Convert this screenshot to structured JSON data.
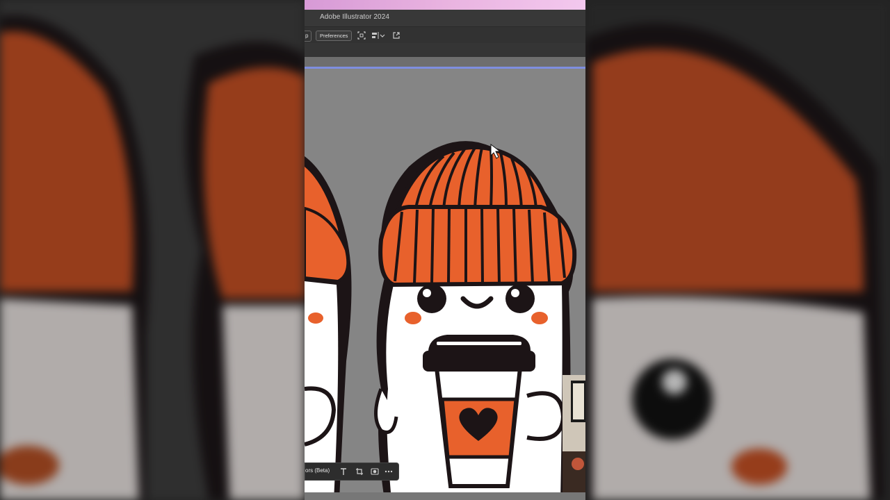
{
  "app": {
    "title": "Adobe Illustrator 2024"
  },
  "toolbar": {
    "partial_button_label": "p",
    "preferences_label": "Preferences"
  },
  "context_bar": {
    "label": "ors (Beta)"
  },
  "icons": [
    "arrange-icon",
    "align-icon",
    "chevron-down-icon",
    "export-icon",
    "type-icon",
    "crop-icon",
    "mask-icon",
    "more-icon",
    "cursor-icon"
  ],
  "colors": {
    "accent_gradient_start": "#d79ad6",
    "beanie": "#e8612c",
    "outline": "#1c1416",
    "canvas": "#858585",
    "selection": "#7c8ff0"
  }
}
